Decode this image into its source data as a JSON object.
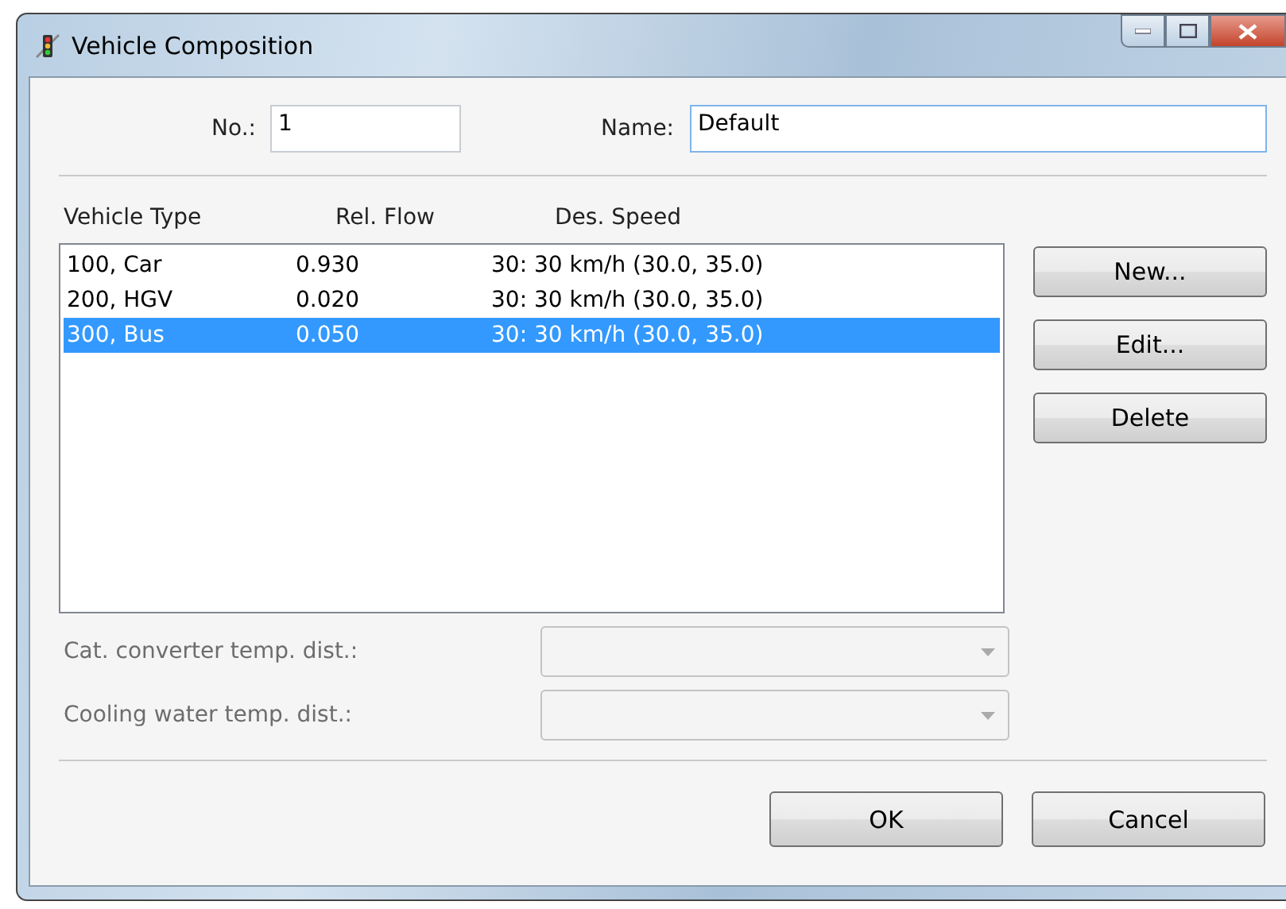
{
  "window": {
    "title": "Vehicle Composition"
  },
  "number": {
    "label": "No.:",
    "value": "1"
  },
  "name": {
    "label": "Name:",
    "value": "Default"
  },
  "table": {
    "columns": [
      "Vehicle Type",
      "Rel. Flow",
      "Des. Speed"
    ],
    "rows": [
      {
        "cells": [
          "100, Car",
          "0.930",
          "30: 30 km/h (30.0, 35.0)"
        ],
        "selected": false
      },
      {
        "cells": [
          "200, HGV",
          "0.020",
          "30: 30 km/h (30.0, 35.0)"
        ],
        "selected": false
      },
      {
        "cells": [
          "300, Bus",
          "0.050",
          "30: 30 km/h (30.0, 35.0)"
        ],
        "selected": true
      }
    ]
  },
  "side_buttons": [
    "New...",
    "Edit...",
    "Delete"
  ],
  "dropdowns": [
    {
      "label": "Cat. converter temp. dist.:",
      "disabled": true
    },
    {
      "label": "Cooling water temp. dist.:",
      "disabled": true
    }
  ],
  "buttons": [
    "OK",
    "Cancel"
  ]
}
